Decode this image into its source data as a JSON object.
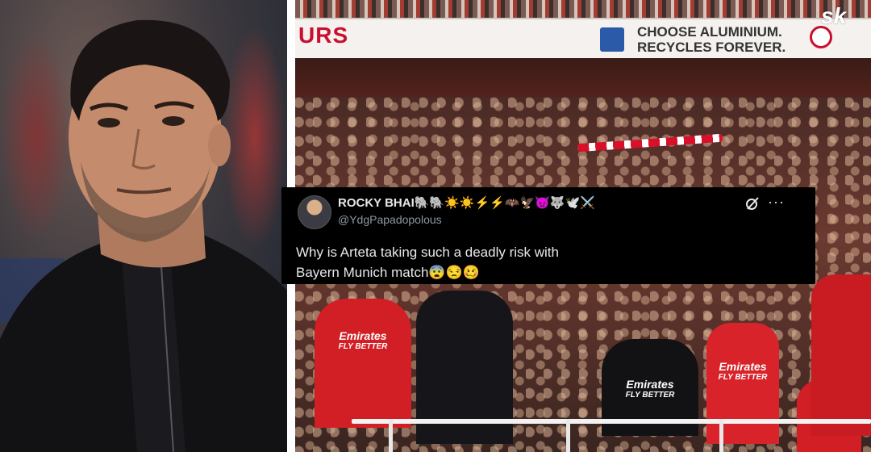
{
  "left_photo": {
    "description_icon": "man-portrait-icon"
  },
  "right_photo": {
    "ad_board": {
      "left_text": "URS",
      "right_text_line1": "CHOOSE ALUMINIUM.",
      "right_text_line2": "RECYCLES FOREVER."
    },
    "watermark": "sk",
    "shirt_sponsor_line1": "Emirates",
    "shirt_sponsor_line2": "FLY BETTER"
  },
  "tweet": {
    "display_name": "ROCKY BHAI🐘🐘☀️☀️⚡⚡🦇🦅😈🐺🕊️⚔️",
    "handle": "@YdgPapadopolous",
    "text_line1": "Why is Arteta taking such a deadly risk with",
    "text_line2": "Bayern Munich match😨😒🥴",
    "more_label": "···",
    "icons": {
      "avatar": "avatar-icon",
      "grok": "grok-icon",
      "more": "more-icon"
    }
  },
  "colors": {
    "tweet_bg": "#000000",
    "tweet_text": "#e7e9ea",
    "handle_text": "#8b98a5",
    "arsenal_red": "#d21f26",
    "ad_red": "#c8102e"
  }
}
